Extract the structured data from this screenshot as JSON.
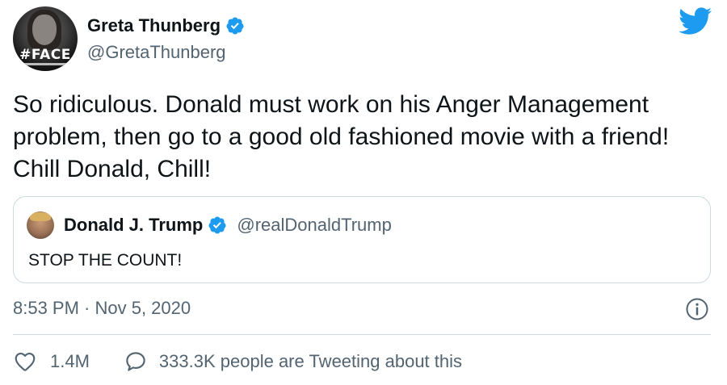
{
  "tweet": {
    "display_name": "Greta Thunberg",
    "handle": "@GretaThunberg",
    "avatar_badge": "#FACE",
    "text": "So ridiculous. Donald must work on his Anger Management problem, then go to a good old fashioned movie with a friend! Chill Donald, Chill!",
    "timestamp": "8:53 PM · Nov 5, 2020",
    "verified_icon": "verified-badge-icon",
    "brand_icon": "twitter-bird-icon"
  },
  "quote": {
    "display_name": "Donald J. Trump",
    "handle": "@realDonaldTrump",
    "text": "STOP THE COUNT!"
  },
  "actions": {
    "like_count": "1.4M",
    "tweeting_text": "333.3K people are Tweeting about this",
    "like_icon": "heart-icon",
    "reply_icon": "speech-bubble-icon",
    "info_icon": "info-icon"
  },
  "colors": {
    "brand_blue": "#1d9bf0",
    "text_primary": "#0f1419",
    "text_secondary": "#536471",
    "border": "#cfd9de"
  }
}
